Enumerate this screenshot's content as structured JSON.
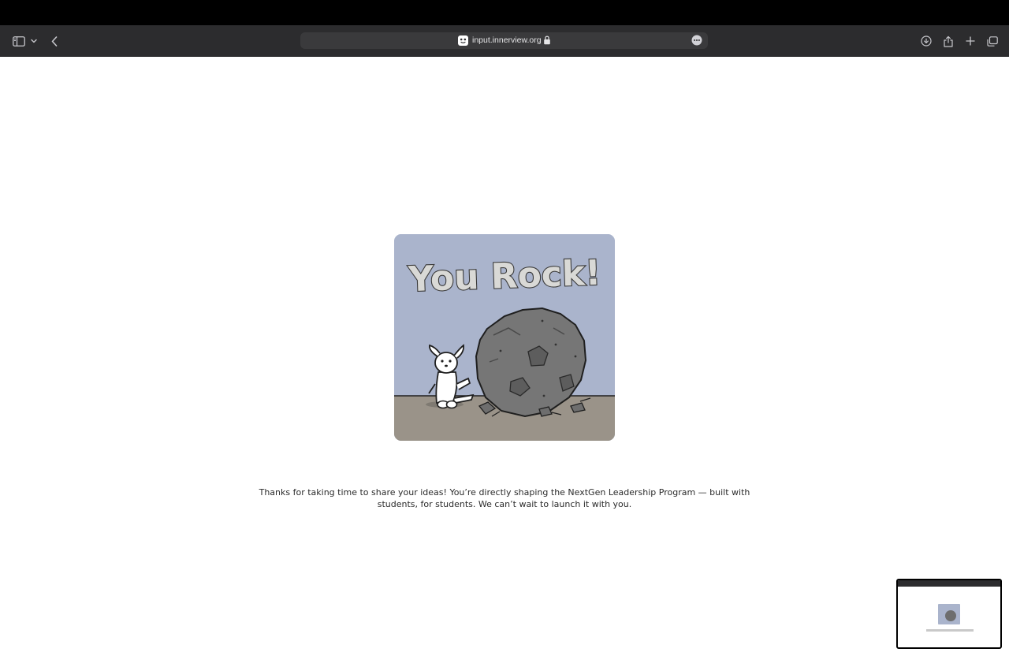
{
  "browser": {
    "url": "input.innerview.org",
    "toolbar_color": "#2c2c2e",
    "icons": [
      "sidebar-icon",
      "chevron-down-icon",
      "back-icon",
      "lock-icon",
      "more-icon",
      "download-icon",
      "share-icon",
      "new-tab-icon",
      "tab-overview-icon"
    ]
  },
  "page": {
    "hero_image": {
      "text": "You Rock!",
      "background_color": "#aab4cc",
      "ground_color": "#9a9389"
    },
    "message": "Thanks for taking  time to share your ideas! You’re directly shaping the NextGen Leadership Program — built with students, for students. We can’t wait to launch it with you."
  }
}
